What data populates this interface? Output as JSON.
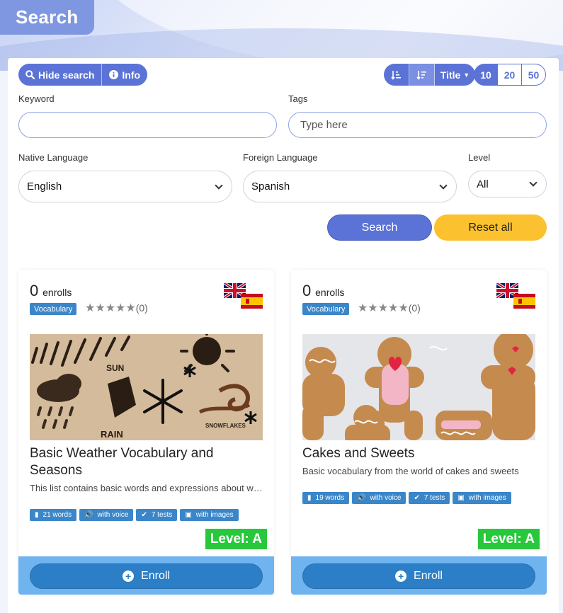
{
  "page": {
    "title": "Search"
  },
  "toolbar": {
    "hide_search": "Hide search",
    "info": "Info",
    "sort_title": "Title",
    "page_sizes": [
      "10",
      "20",
      "50"
    ]
  },
  "filters": {
    "keyword_label": "Keyword",
    "keyword_value": "",
    "tags_label": "Tags",
    "tags_placeholder": "Type here",
    "native_label": "Native Language",
    "native_value": "English",
    "foreign_label": "Foreign Language",
    "foreign_value": "Spanish",
    "level_label": "Level",
    "level_value": "All",
    "search_button": "Search",
    "reset_button": "Reset all"
  },
  "cards": [
    {
      "enrolls_count": "0",
      "enrolls_label": "enrolls",
      "category": "Vocabulary",
      "rating": "(0)",
      "title": "Basic Weather Vocabulary and Seasons",
      "description": "This list contains basic words and expressions about weather and seasons",
      "tags": [
        "21 words",
        "with voice",
        "7 tests",
        "with images"
      ],
      "level": "Level: A",
      "enroll": "Enroll"
    },
    {
      "enrolls_count": "0",
      "enrolls_label": "enrolls",
      "category": "Vocabulary",
      "rating": "(0)",
      "title": "Cakes and Sweets",
      "description": "Basic vocabulary from the world of cakes and sweets",
      "tags": [
        "19 words",
        "with voice",
        "7 tests",
        "with images"
      ],
      "level": "Level: A",
      "enroll": "Enroll"
    }
  ],
  "colors": {
    "primary": "#5b73d6",
    "accent_yellow": "#fcc12f",
    "card_blue": "#3a86c8",
    "level_green": "#28c83c"
  }
}
